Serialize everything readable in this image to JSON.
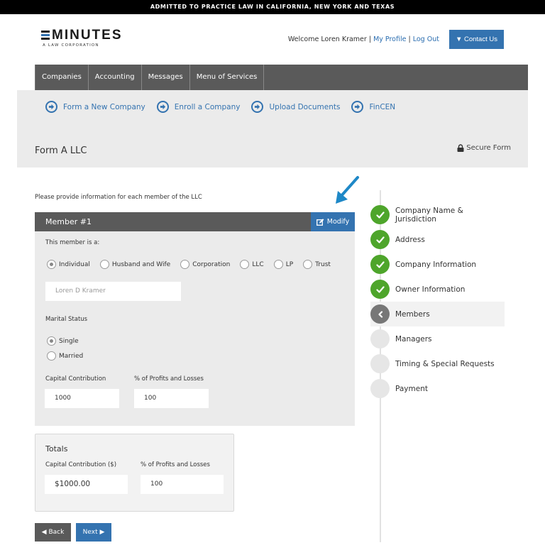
{
  "banner": "ADMITTED TO PRACTICE LAW IN CALIFORNIA, NEW YORK AND TEXAS",
  "logo": {
    "name": "MINUTES",
    "tagline": "A LAW CORPORATION",
    "accent": "#3473b0"
  },
  "header": {
    "welcome": "Welcome Loren Kramer",
    "separator": "|",
    "my_profile": "My Profile",
    "log_out": "Log Out",
    "contact_label": "▼ Contact Us"
  },
  "nav": [
    "Companies",
    "Accounting",
    "Messages",
    "Menu of Services"
  ],
  "subnav": [
    "Form a New Company",
    "Enroll a Company",
    "Upload Documents",
    "FinCEN"
  ],
  "page": {
    "title": "Form A LLC",
    "secure_label": "Secure Form"
  },
  "form": {
    "instructions": "Please provide information for each member of the LLC",
    "member": {
      "title": "Member #1",
      "modify_label": "Modify",
      "type_label": "This member is a:",
      "types": [
        "Individual",
        "Husband and Wife",
        "Corporation",
        "LLC",
        "LP",
        "Trust"
      ],
      "selected_type": "Individual",
      "name_value": "Loren D Kramer",
      "marital_label": "Marital Status",
      "marital_options": [
        "Single",
        "Married"
      ],
      "selected_marital": "Single",
      "capital_label": "Capital Contribution",
      "capital_value": "1000",
      "profits_label": "% of Profits and Losses",
      "profits_value": "100"
    },
    "totals": {
      "title": "Totals",
      "capital_label": "Capital Contribution ($)",
      "capital_value": "$1000.00",
      "profits_label": "% of Profits and Losses",
      "profits_value": "100"
    },
    "back_label": "◀ Back",
    "next_label": "Next ▶"
  },
  "steps": [
    {
      "label": "Company Name & Jurisdiction",
      "status": "done"
    },
    {
      "label": "Address",
      "status": "done"
    },
    {
      "label": "Company Information",
      "status": "done"
    },
    {
      "label": "Owner Information",
      "status": "done"
    },
    {
      "label": "Members",
      "status": "current"
    },
    {
      "label": "Managers",
      "status": "todo"
    },
    {
      "label": "Timing & Special Requests",
      "status": "todo"
    },
    {
      "label": "Payment",
      "status": "todo"
    }
  ],
  "colors": {
    "primary": "#3473b0",
    "dark": "#5a5a5a",
    "success": "#4ea52b",
    "annotation_arrow": "#1e88c7"
  }
}
